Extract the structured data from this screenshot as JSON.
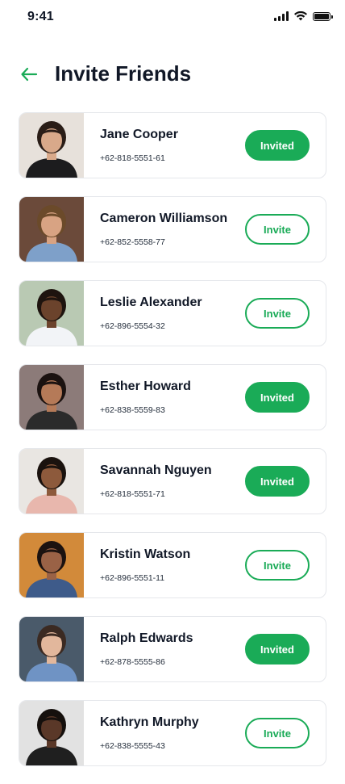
{
  "status_bar": {
    "time": "9:41",
    "icons": [
      "signal-icon",
      "wifi-icon",
      "battery-icon"
    ]
  },
  "header": {
    "title": "Invite Friends",
    "back_icon": "arrow-left-icon"
  },
  "colors": {
    "accent": "#1aab57",
    "card_border": "#e5e7eb",
    "text": "#111827"
  },
  "friends": [
    {
      "name": "Jane Cooper",
      "phone": "+62-818-5551-61",
      "status": "Invited",
      "photo": {
        "bg": "#e7e1db",
        "skin": "#d9a98a",
        "hair": "#2a1d17",
        "shirt": "#1c1c1e"
      }
    },
    {
      "name": "Cameron Williamson",
      "phone": "+62-852-5558-77",
      "status": "Invite",
      "photo": {
        "bg": "#6b4a3a",
        "skin": "#d8a383",
        "hair": "#6b4a2a",
        "shirt": "#7ea0c9"
      }
    },
    {
      "name": "Leslie Alexander",
      "phone": "+62-896-5554-32",
      "status": "Invite",
      "photo": {
        "bg": "#b9c9b3",
        "skin": "#6b432c",
        "hair": "#1e140f",
        "shirt": "#f2f4f7"
      }
    },
    {
      "name": "Esther Howard",
      "phone": "+62-838-5559-83",
      "status": "Invited",
      "photo": {
        "bg": "#8c7b79",
        "skin": "#b57a58",
        "hair": "#1b1210",
        "shirt": "#2b2b2b"
      }
    },
    {
      "name": "Savannah Nguyen",
      "phone": "+62-818-5551-71",
      "status": "Invited",
      "photo": {
        "bg": "#e9e6e2",
        "skin": "#8d5a3c",
        "hair": "#1a120e",
        "shirt": "#e8b7ad"
      }
    },
    {
      "name": "Kristin Watson",
      "phone": "+62-896-5551-11",
      "status": "Invite",
      "photo": {
        "bg": "#d28a3a",
        "skin": "#9a6246",
        "hair": "#1b1210",
        "shirt": "#3e5b8a"
      }
    },
    {
      "name": "Ralph Edwards",
      "phone": "+62-878-5555-86",
      "status": "Invited",
      "photo": {
        "bg": "#4a5a6a",
        "skin": "#e2b79c",
        "hair": "#3b2a22",
        "shirt": "#6f93c4"
      }
    },
    {
      "name": "Kathryn Murphy",
      "phone": "+62-838-5555-43",
      "status": "Invite",
      "photo": {
        "bg": "#e2e2e2",
        "skin": "#5a3828",
        "hair": "#15100d",
        "shirt": "#1f1f1f"
      }
    }
  ]
}
